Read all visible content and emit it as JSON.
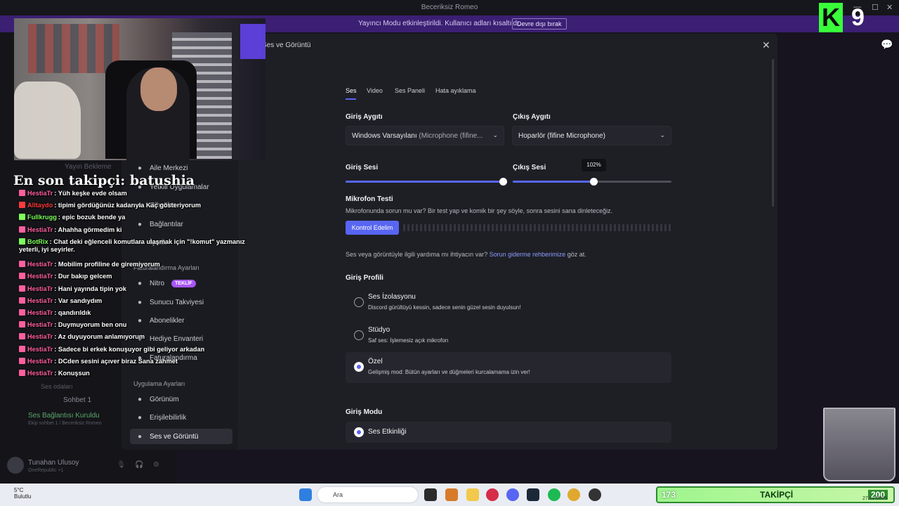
{
  "window": {
    "title": "Beceriksiz Romeo"
  },
  "notice": {
    "message": "Yayıncı Modu etkinleştirildi. Kullanıcı adları kısaltıldı.",
    "button": "Devre dışı bırak"
  },
  "background": {
    "user_name": "Tunahan Ulusoy",
    "user_status": "OneRepublic +1",
    "voice_status": "Ses Bağlantısı Kuruldu",
    "voice_sub": "Ekip sohbet 1 / Beceriksiz Romeo",
    "channel_voice": "Sohbet 1",
    "channel_rooms": "Ses odaları",
    "waiting": "Yayın Bekleme"
  },
  "modal": {
    "title": "Ses ve Görüntü",
    "close": "✕",
    "sidebar": {
      "items_top": [
        {
          "label": "Aile Merkezi",
          "icon": "people-icon"
        },
        {
          "label": "Yetkili Uygulamalar",
          "icon": "apps-icon"
        },
        {
          "label": "Cihazlar",
          "icon": "device-icon"
        },
        {
          "label": "Bağlantılar",
          "icon": "link-icon"
        },
        {
          "label": "İçerik",
          "icon": "content-icon"
        }
      ],
      "billing_header": "Faturalandırma Ayarları",
      "items_billing": [
        {
          "label": "Nitro",
          "icon": "nitro-icon",
          "badge": "TEKLİF"
        },
        {
          "label": "Sunucu Takviyesi",
          "icon": "boost-icon"
        },
        {
          "label": "Abonelikler",
          "icon": "subscription-icon"
        },
        {
          "label": "Hediye Envanteri",
          "icon": "gift-icon"
        },
        {
          "label": "Faturalandırma",
          "icon": "card-icon"
        }
      ],
      "app_header": "Uygulama Ayarları",
      "items_app": [
        {
          "label": "Görünüm",
          "icon": "palette-icon"
        },
        {
          "label": "Erişilebilirlik",
          "icon": "accessibility-icon"
        },
        {
          "label": "Ses ve Görüntü",
          "icon": "mic-icon",
          "active": true
        }
      ]
    },
    "tabs": [
      "Ses",
      "Video",
      "Ses Paneli",
      "Hata ayıklama"
    ],
    "input_device": {
      "label": "Giriş Aygıtı",
      "value": "Windows Varsayılanı",
      "value_muted": "(Microphone (fifine..."
    },
    "output_device": {
      "label": "Çıkış Aygıtı",
      "value": "Hoparlör (fifine Microphone)"
    },
    "input_volume": {
      "label": "Giriş Sesi",
      "value": 1.0
    },
    "output_volume": {
      "label": "Çıkış Sesi",
      "value": 0.51,
      "tooltip": "102%"
    },
    "mic_test": {
      "label": "Mikrofon Testi",
      "desc": "Mikrofonunda sorun mu var? Bir test yap ve komik bir şey söyle, sonra sesini sana dinleteceğiz.",
      "button": "Kontrol Edelim"
    },
    "help": {
      "pre": "Ses veya görüntüyle ilgili yardıma mı ihtiyacın var?",
      "link": "Sorun giderme rehberimize",
      "post": "göz at."
    },
    "input_profile": {
      "label": "Giriş Profili",
      "options": [
        {
          "title": "Ses İzolasyonu",
          "desc": "Discord gürültüyü kessin, sadece senin güzel sesin duyulsun!",
          "selected": false
        },
        {
          "title": "Stüdyo",
          "desc": "Saf ses: İşlemesiz açık mikrofon",
          "selected": false
        },
        {
          "title": "Özel",
          "desc": "Gelişmiş mod: Bütün ayarları ve düğmeleri kurcalamama izin ver!",
          "selected": true
        }
      ]
    },
    "input_mode": {
      "label": "Giriş Modu",
      "option": "Ses Etkinliği"
    }
  },
  "overlay": {
    "last_follower": "En son takipçi: batushia",
    "chat": [
      {
        "user": "HestiaTr",
        "text": ": Yüh keşke evde olsam",
        "color": "#ff5fa0"
      },
      {
        "user": "Alltaydo",
        "text": ": tipimi gördüğünüz kadarıyla Kaç gösteriyorum",
        "color": "#ff3b3b"
      },
      {
        "user": "Fullkrugg",
        "text": ": epic bozuk bende ya",
        "color": "#7dff5a"
      },
      {
        "user": "HestiaTr",
        "text": ": Ahahha görmedim ki",
        "color": "#ff5fa0"
      },
      {
        "user": "BotRix",
        "text": ": Chat deki eğlenceli komutlara ulaşmak için \"!komut\" yazmanız",
        "color": "#7dff5a"
      },
      {
        "user": "",
        "text": "yeterli, iyi seyirler.",
        "color": "#ffffff"
      },
      {
        "user": "HestiaTr",
        "text": ": Mobilim profiline de giremiyorum",
        "color": "#ff5fa0"
      },
      {
        "user": "HestiaTr",
        "text": ": Dur bakıp gelcem",
        "color": "#ff5fa0"
      },
      {
        "user": "HestiaTr",
        "text": ": Hani yayında tipin yok",
        "color": "#ff5fa0"
      },
      {
        "user": "HestiaTr",
        "text": ": Var sandıydım",
        "color": "#ff5fa0"
      },
      {
        "user": "HestiaTr",
        "text": ": qandırıldık",
        "color": "#ff5fa0"
      },
      {
        "user": "HestiaTr",
        "text": ": Duymuyorum ben onu",
        "color": "#ff5fa0"
      },
      {
        "user": "HestiaTr",
        "text": ": Az duyuyorum anlamıyorum",
        "color": "#ff5fa0"
      },
      {
        "user": "HestiaTr",
        "text": ": Sadece bi erkek konuşuyor gibi geliyor arkadan",
        "color": "#ff5fa0"
      },
      {
        "user": "HestiaTr",
        "text": ": DCden sesini açıver biraz Sana zahmet",
        "color": "#ff5fa0"
      },
      {
        "user": "HestiaTr",
        "text": ": Konuşsun",
        "color": "#ff5fa0"
      }
    ],
    "k9": {
      "letter": "K",
      "number": "9"
    }
  },
  "taskbar": {
    "temp": "5°C",
    "weather": "Bulutlu",
    "search_placeholder": "Ara",
    "follow_bar": {
      "current": "173",
      "label": "TAKİPÇİ",
      "goal": "200",
      "progress": 0.865
    },
    "clock_date": "27.12.2025"
  }
}
